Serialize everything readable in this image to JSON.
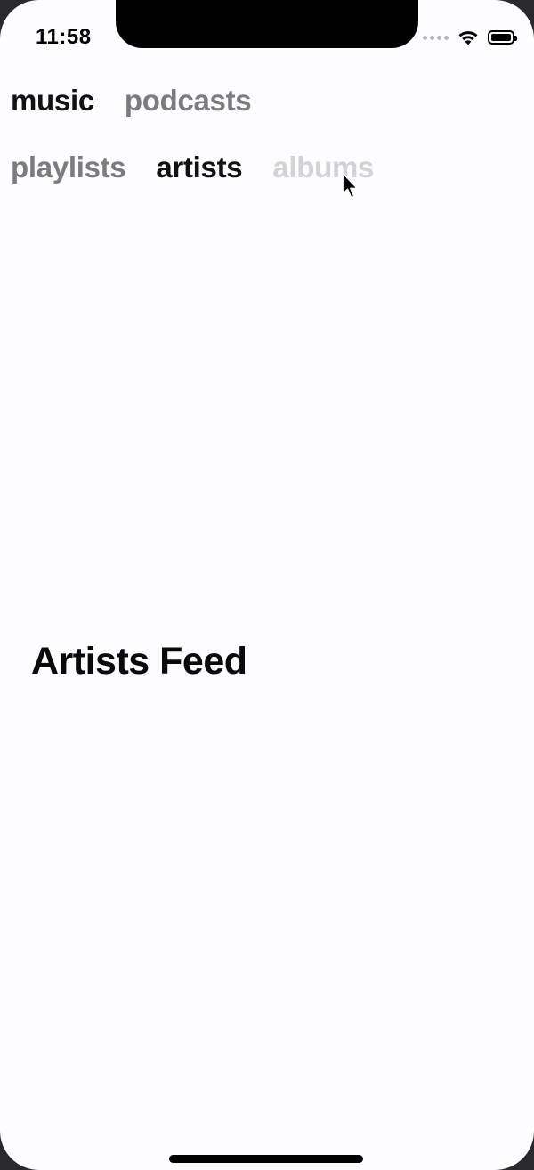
{
  "status_bar": {
    "time": "11:58",
    "signal_icon": "signal-dots-icon",
    "wifi_icon": "wifi-icon",
    "battery_icon": "battery-icon",
    "battery_level": 1.0
  },
  "tabs_primary": [
    {
      "label": "music",
      "state": "active"
    },
    {
      "label": "podcasts",
      "state": "inactive"
    }
  ],
  "tabs_secondary": [
    {
      "label": "playlists",
      "state": "inactive"
    },
    {
      "label": "artists",
      "state": "active"
    },
    {
      "label": "albums",
      "state": "faded"
    }
  ],
  "main": {
    "title": "Artists Feed"
  },
  "colors": {
    "background": "#fdfcfe",
    "active_tab": "#111111",
    "inactive_tab": "#7c7b80",
    "faded_tab": "#d3d2d6"
  }
}
